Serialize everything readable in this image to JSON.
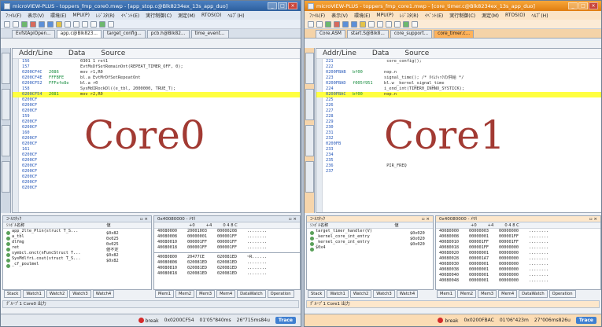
{
  "left": {
    "title": "microVIEW-PLUS - toppers_fmp_core0.mwp - [app_stop.c@Blk8234ex_13s_app_duo]",
    "menu": [
      "ﾌｧｲﾙ(F)",
      "表示(V)",
      "環境(E)",
      "MPU(P)",
      "ﾚｼﾞｽﾀ(R)",
      "ｲﾍﾞﾝﾄ(E)",
      "実行制御(C)",
      "測定(M)",
      "RTOS(O)",
      "ﾍﾙﾌﾟ(H)"
    ],
    "tabs": [
      "EvfstApiOpen...",
      "app.c@Blk823...",
      "target_config...",
      "pcb.h@Blk82...",
      "time_event..."
    ],
    "src_head": {
      "addr": "Addr/Line",
      "data": "Data",
      "source": "Source"
    },
    "lines": [
      {
        "a": "156",
        "d": "",
        "s": "0301 1 ret1"
      },
      {
        "a": "157",
        "d": "",
        "s": "EvtMsDfSetRemainOnt(REPEAT_TIMER_OFF, 0);"
      },
      {
        "a": "0200CF4C",
        "d": "2086",
        "s": "mov     r1,R0"
      },
      {
        "a": "0200CF4E",
        "d": "FFFBFE",
        "s": "bl.a    EvtMrDfSetRepeatOnt"
      },
      {
        "a": "0200CF52",
        "d": "FFFefe8e",
        "s": "bl.a    r0"
      },
      {
        "a": "158",
        "d": "",
        "s": "SysMdIRockDl((e_tbl, 2000000, TRUE_T);"
      },
      {
        "a": "0200CF54",
        "d": "2081",
        "s": "mov     r2,R0",
        "hl": true
      },
      {
        "a": "0200CF",
        "d": "",
        "s": ""
      },
      {
        "a": "0200CF",
        "d": "",
        "s": ""
      },
      {
        "a": "0200CF",
        "d": "",
        "s": ""
      },
      {
        "a": "159",
        "d": "",
        "s": ""
      },
      {
        "a": "0200CF",
        "d": "",
        "s": ""
      },
      {
        "a": "0200CF",
        "d": "",
        "s": ""
      },
      {
        "a": "160",
        "d": "",
        "s": ""
      },
      {
        "a": "0200CF",
        "d": "",
        "s": ""
      },
      {
        "a": "0200CF",
        "d": "",
        "s": ""
      },
      {
        "a": "161",
        "d": "",
        "s": ""
      },
      {
        "a": "0200CF",
        "d": "",
        "s": ""
      },
      {
        "a": "0200CF",
        "d": "",
        "s": ""
      },
      {
        "a": "0200CF",
        "d": "",
        "s": ""
      },
      {
        "a": "0200CF",
        "d": "",
        "s": ""
      },
      {
        "a": "0200CF",
        "d": "",
        "s": ""
      },
      {
        "a": "0200CF",
        "d": "",
        "s": ""
      },
      {
        "a": "0200CF",
        "d": "",
        "s": ""
      }
    ],
    "big_label": "Core0",
    "callstack": {
      "title": "ｺｰﾙｽﾀｯｸ",
      "cols": [
        "ｼﾝﾎﾞﾙ名称",
        "値"
      ],
      "rows": [
        {
          "n": "app_2lte_Plin(struct T_S...",
          "v": "$0x82"
        },
        {
          "n": "a_tbl",
          "v": "0x025"
        },
        {
          "n": "dlfmg",
          "v": "0x025"
        },
        {
          "n": "ret",
          "v": "値不定"
        },
        {
          "n": "symbcl.onct(nFuncStruct T...",
          "v": "$0x82"
        },
        {
          "n": "SysMdlfri.cout(struct T_S...",
          "v": "$0x82"
        },
        {
          "n": "_cf_poulmel",
          "v": ""
        }
      ]
    },
    "memory": {
      "title": "0x40080000 - ﾒﾓﾘ",
      "cols": [
        "+0",
        "+4",
        "0 4 8 C"
      ],
      "rows": [
        {
          "a": "40080000",
          "v1": "20001003",
          "v2": "00000208",
          "t": "........"
        },
        {
          "a": "40080008",
          "v1": "00000001",
          "v2": "000001FF",
          "t": "........"
        },
        {
          "a": "40080010",
          "v1": "000001FF",
          "v2": "000001FF",
          "t": "........"
        },
        {
          "a": "40080018",
          "v1": "000001FF",
          "v2": "000001FF",
          "t": "........"
        },
        {
          "a": "40080800",
          "v1": "20477CE",
          "v2": "020081ED",
          "t": "~R......"
        },
        {
          "a": "40080808",
          "v1": "020081ED",
          "v2": "020081ED",
          "t": "........"
        },
        {
          "a": "40080810",
          "v1": "020081ED",
          "v2": "020081ED",
          "t": "........"
        },
        {
          "a": "40080818",
          "v1": "020081ED",
          "v2": "020081ED",
          "t": "........"
        }
      ]
    },
    "tabstrip_a": [
      "Stack",
      "Watch1",
      "Watch2",
      "Watch3",
      "Watch4"
    ],
    "tabstrip_b": [
      "Mem1",
      "Mem2",
      "Mem3",
      "Mem4",
      "DataWatch",
      "Operation"
    ],
    "outbar": "ｸﾞﾙｰﾌﾟ1 Core0  出力",
    "status": {
      "brk": "break",
      "pc": "0x0200CF54",
      "t1": "01'05\"840ms",
      "t2": "26\"715ms84u",
      "trace": "Trace"
    }
  },
  "right": {
    "title": "microVIEW-PLUS - toppers_fmp_core1.mwp - [core_timer.c@Blk8234ex_13s_app_duo]",
    "menu": [
      "ﾌｧｲﾙ(F)",
      "表示(V)",
      "環境(E)",
      "MPU(P)",
      "ﾚｼﾞｽﾀ(R)",
      "ｲﾍﾞﾝﾄ(E)",
      "実行制御(C)",
      "測定(M)",
      "RTOS(O)",
      "ﾍﾙﾌﾟ(H)"
    ],
    "tabs": [
      "Core.ASM",
      "start.S@Blk8...",
      "core_support...",
      "core_timer.c..."
    ],
    "src_head": {
      "addr": "Addr/Line",
      "data": "Data",
      "source": "Source"
    },
    "lines": [
      {
        "a": "221",
        "d": "",
        "s": "    core_config();"
      },
      {
        "a": "222",
        "d": "",
        "s": ""
      },
      {
        "a": "0200FBAB",
        "d": "bf00",
        "s": "nop.n"
      },
      {
        "a": "223",
        "d": "",
        "s": "signal_time();       /* ﾀｲﾑﾃｨｯｸの供給 */"
      },
      {
        "a": "0200FBAD",
        "d": "f005f951",
        "s": "bl.w    _kernel_signal_time"
      },
      {
        "a": "224",
        "d": "",
        "s": "i_end_int(TIMER0_INHNO_SYSTICK);"
      },
      {
        "a": "0200FBAC",
        "d": "bf00",
        "s": "nop.n",
        "hl": true
      },
      {
        "a": "225",
        "d": "",
        "s": ""
      },
      {
        "a": "226",
        "d": "",
        "s": ""
      },
      {
        "a": "227",
        "d": "",
        "s": ""
      },
      {
        "a": "228",
        "d": "",
        "s": ""
      },
      {
        "a": "229",
        "d": "",
        "s": ""
      },
      {
        "a": "230",
        "d": "",
        "s": ""
      },
      {
        "a": "231",
        "d": "",
        "s": ""
      },
      {
        "a": "232",
        "d": "",
        "s": ""
      },
      {
        "a": "0200FB",
        "d": "",
        "s": ""
      },
      {
        "a": "233",
        "d": "",
        "s": ""
      },
      {
        "a": "234",
        "d": "",
        "s": ""
      },
      {
        "a": "235",
        "d": "",
        "s": ""
      },
      {
        "a": "236",
        "d": "",
        "s": "                              PIR_FREQ"
      },
      {
        "a": "237",
        "d": "",
        "s": ""
      }
    ],
    "big_label": "Core1",
    "callstack": {
      "title": "ｺｰﾙｽﾀｯｸ",
      "cols": [
        "ｼﾝﾎﾞﾙ名称",
        "値"
      ],
      "rows": [
        {
          "n": "target_timer_handler(V)",
          "v": "$0x020"
        },
        {
          "n": "_kernel_core_int_entry",
          "v": "$0x020"
        },
        {
          "n": "_kernel_core_int_entry",
          "v": "$0x020"
        },
        {
          "n": "$0x4",
          "v": ""
        }
      ]
    },
    "memory": {
      "title": "0x40080000 - ﾒﾓﾘ",
      "cols": [
        "+0",
        "+4",
        "0 4 8 C"
      ],
      "rows": [
        {
          "a": "40080000",
          "v1": "00000003",
          "v2": "00000000",
          "t": "........"
        },
        {
          "a": "40080008",
          "v1": "00000001",
          "v2": "000001FF",
          "t": "........"
        },
        {
          "a": "40080010",
          "v1": "000001FF",
          "v2": "000001FF",
          "t": "........"
        },
        {
          "a": "40080018",
          "v1": "000001FF",
          "v2": "00000000",
          "t": "........"
        },
        {
          "a": "40080020",
          "v1": "00000001",
          "v2": "00000000",
          "t": "........"
        },
        {
          "a": "40080028",
          "v1": "000001A7",
          "v2": "00000000",
          "t": "........"
        },
        {
          "a": "40080030",
          "v1": "00000001",
          "v2": "00000000",
          "t": "........"
        },
        {
          "a": "40080038",
          "v1": "00000001",
          "v2": "00000000",
          "t": "........"
        },
        {
          "a": "40080040",
          "v1": "00000001",
          "v2": "00000000",
          "t": "........"
        },
        {
          "a": "40080048",
          "v1": "00000001",
          "v2": "00000000",
          "t": "........"
        }
      ]
    },
    "tabstrip_a": [
      "Stack",
      "Watch1",
      "Watch2",
      "Watch3",
      "Watch4"
    ],
    "tabstrip_b": [
      "Mem1",
      "Mem2",
      "Mem3",
      "Mem4",
      "DataWatch",
      "Operation"
    ],
    "outbar": "ｸﾞﾙｰﾌﾟ1 Core1  出力",
    "status": {
      "brk": "break",
      "pc": "0x0200FBAC",
      "t1": "01'06\"423m",
      "t2": "27\"006ms826u",
      "trace": "Trace"
    }
  }
}
